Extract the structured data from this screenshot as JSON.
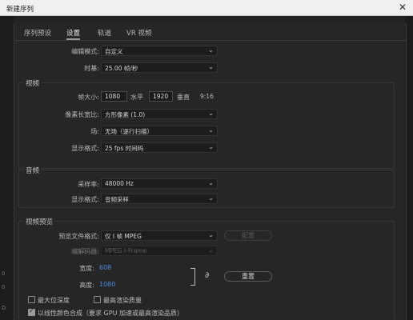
{
  "window": {
    "title": "新建序列",
    "close_glyph": "✕"
  },
  "tabs": [
    {
      "label": "序列预设",
      "active": false
    },
    {
      "label": "设置",
      "active": true
    },
    {
      "label": "轨道",
      "active": false
    },
    {
      "label": "VR 视频",
      "active": false
    }
  ],
  "general": {
    "edit_mode_label": "编辑模式:",
    "edit_mode_value": "自定义",
    "timebase_label": "时基:",
    "timebase_value": "25.00  帧/秒"
  },
  "video": {
    "title": "视频",
    "frame_size_label": "帧大小:",
    "frame_width": "1080",
    "horizontal_label": "水平",
    "frame_height": "1920",
    "vertical_label": "垂直",
    "aspect": "9:16",
    "pixel_aspect_label": "像素长宽比:",
    "pixel_aspect_value": "方形像素 (1.0)",
    "fields_label": "场:",
    "fields_value": "无场（逐行扫描）",
    "display_format_label": "显示格式:",
    "display_format_value": "25 fps 时间码"
  },
  "audio": {
    "title": "音频",
    "sample_rate_label": "采样率:",
    "sample_rate_value": "48000 Hz",
    "display_format_label": "显示格式:",
    "display_format_value": "音频采样"
  },
  "preview": {
    "title": "视频预览",
    "file_format_label": "预览文件格式:",
    "file_format_value": "仅 I 帧 MPEG",
    "configure_button": "配置",
    "codec_label": "编解码器:",
    "codec_value": "MPEG I-Frame",
    "width_label": "宽度:",
    "width_value": "608",
    "height_label": "高度:",
    "height_value": "1080",
    "reset_button": "重置"
  },
  "options": [
    {
      "label": "最大位深度",
      "checked": false
    },
    {
      "label": "最高渲染质量",
      "checked": false
    },
    {
      "label": "以线性颜色合成（要求 GPU 加速或最高渲染品质）",
      "checked": true
    }
  ],
  "chevron": "⌄",
  "link_glyph": "∂",
  "left_marks": [
    "0",
    "0",
    "D"
  ]
}
